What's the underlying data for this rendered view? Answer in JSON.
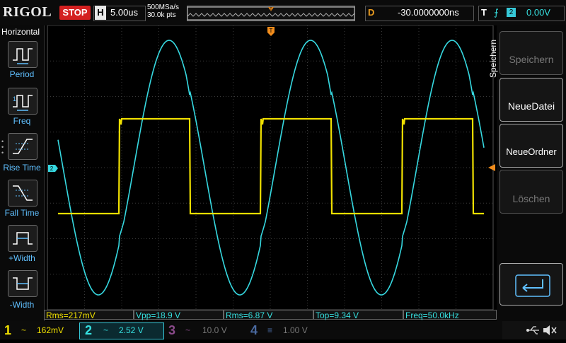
{
  "topbar": {
    "brand": "RIGOL",
    "run_state": "STOP",
    "horizontal_letter": "H",
    "timebase": "5.00us",
    "sample_rate": "500MSa/s",
    "points": "30.0k pts",
    "delay_letter": "D",
    "delay": "-30.0000000ns",
    "trigger_letter": "T",
    "trigger_edge": "⨍",
    "trigger_source": "2",
    "trigger_level": "0.00V"
  },
  "left_menu": {
    "title": "Horizontal",
    "items": [
      {
        "label": "Period"
      },
      {
        "label": "Freq"
      },
      {
        "label": "Rise Time"
      },
      {
        "label": "Fall Time"
      },
      {
        "label": "+Width"
      },
      {
        "label": "-Width"
      }
    ]
  },
  "right_menu": {
    "title": "Speichern",
    "items": [
      {
        "label": "Speichern",
        "enabled": false
      },
      {
        "label": "NeueDatei",
        "enabled": true
      },
      {
        "label": "NeueOrdner",
        "enabled": true
      },
      {
        "label": "Löschen",
        "enabled": false
      },
      {
        "label": "",
        "icon": "enter-icon",
        "enabled": true
      }
    ]
  },
  "markers": {
    "ch2_ground": "2",
    "trigger_pos": "T"
  },
  "measurements": [
    {
      "label": "Rms=217mV",
      "color": "#f0e000"
    },
    {
      "label": "Vpp=18.9 V",
      "color": "#36e0e0"
    },
    {
      "label": "Rms=6.87 V",
      "color": "#36e0e0"
    },
    {
      "label": "Top=9.34 V",
      "color": "#36e0e0"
    },
    {
      "label": "Freq=50.0kHz",
      "color": "#36e0e0"
    }
  ],
  "channels": [
    {
      "num": "1",
      "coupling": "~",
      "scale": "162mV",
      "color": "#f0e000",
      "active": true
    },
    {
      "num": "2",
      "coupling": "~",
      "scale": "2.52 V",
      "color": "#36e0e0",
      "active": true
    },
    {
      "num": "3",
      "coupling": "~",
      "scale": "10.0 V",
      "color": "#c060c0",
      "active": false
    },
    {
      "num": "4",
      "coupling": "≡",
      "scale": "1.00 V",
      "color": "#4080e0",
      "active": false
    }
  ],
  "colors": {
    "ch1": "#f0e000",
    "ch2": "#36d8e0",
    "trigger": "#f08c1c",
    "menu_label": "#60c0ff"
  }
}
